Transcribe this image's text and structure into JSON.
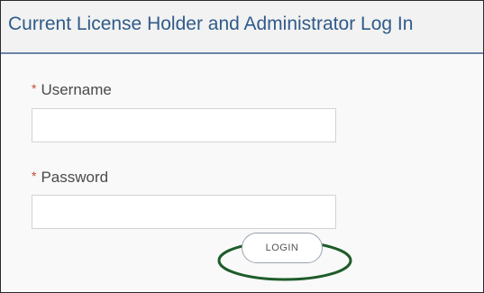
{
  "header": {
    "title": "Current License Holder and Administrator Log In"
  },
  "form": {
    "required_marker": "*",
    "username_label": "Username",
    "username_value": "",
    "password_label": "Password",
    "password_value": "",
    "login_label": "LOGIN"
  },
  "colors": {
    "title": "#2f5b8a",
    "header_rule": "#6b87a8",
    "required_marker": "#c44a3c",
    "highlight_ellipse": "#1e5c2a"
  }
}
